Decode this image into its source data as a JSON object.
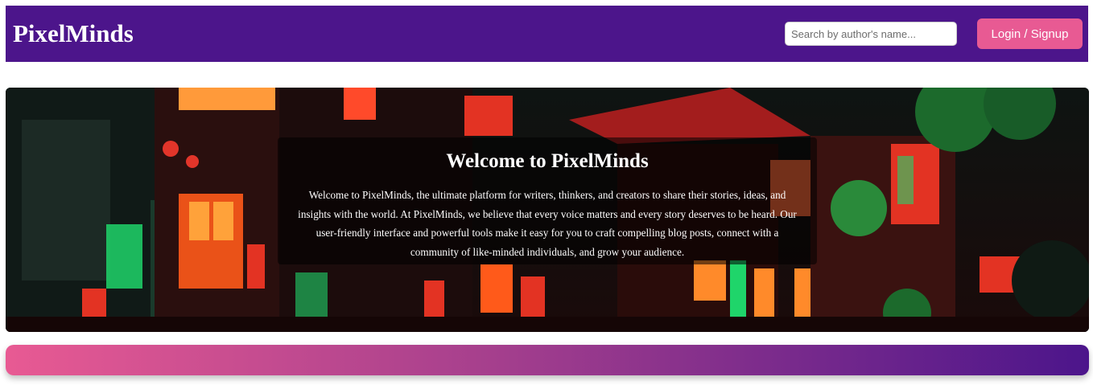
{
  "header": {
    "logo": "PixelMinds",
    "search_placeholder": "Search by author's name...",
    "login_label": "Login / Signup"
  },
  "hero": {
    "title": "Welcome to PixelMinds",
    "text": "Welcome to PixelMinds, the ultimate platform for writers, thinkers, and creators to share their stories, ideas, and insights with the world. At PixelMinds, we believe that every voice matters and every story deserves to be heard. Our user-friendly interface and powerful tools make it easy for you to craft compelling blog posts, connect with a community of like-minded individuals, and grow your audience.",
    "background": "neon-city-night-illustration"
  },
  "colors": {
    "brand_purple": "#4c158b",
    "accent_pink": "#e85a93"
  }
}
